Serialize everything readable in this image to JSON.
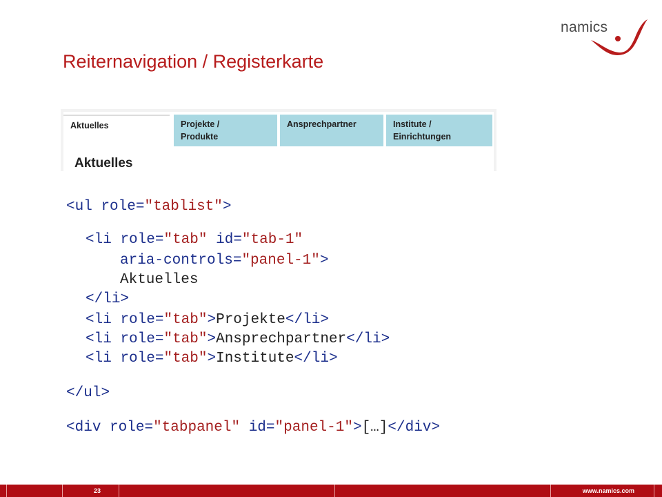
{
  "logo": {
    "text": "namics"
  },
  "title": "Reiternavigation / Registerkarte",
  "tabs": [
    {
      "line1": "Aktuelles",
      "line2": ""
    },
    {
      "line1": "Projekte /",
      "line2": "Produkte"
    },
    {
      "line1": "Ansprechpartner",
      "line2": ""
    },
    {
      "line1": "Institute /",
      "line2": "Einrichtungen"
    }
  ],
  "panel_heading": "Aktuelles",
  "code": {
    "ul_open": {
      "tag": "ul",
      "attr": "role",
      "val": "\"tablist\""
    },
    "li1": {
      "tag": "li",
      "attr1": "role",
      "val1": "\"tab\"",
      "attr2": "id",
      "val2": "\"tab-1\"",
      "attr3": "aria-controls",
      "val3": "\"panel-1\"",
      "text": "Aktuelles",
      "close_tag": "li"
    },
    "li2": {
      "tag": "li",
      "attr": "role",
      "val": "\"tab\"",
      "text": "Projekte",
      "close_tag": "li"
    },
    "li3": {
      "tag": "li",
      "attr": "role",
      "val": "\"tab\"",
      "text": "Ansprechpartner",
      "close_tag": "li"
    },
    "li4": {
      "tag": "li",
      "attr": "role",
      "val": "\"tab\"",
      "text": "Institute",
      "close_tag": "li"
    },
    "ul_close": {
      "tag": "ul"
    },
    "div": {
      "tag": "div",
      "attr1": "role",
      "val1": "\"tabpanel\"",
      "attr2": "id",
      "val2": "\"panel-1\"",
      "text": "[…]",
      "close_tag": "div"
    }
  },
  "footer": {
    "page": "23",
    "url": "www.namics.com"
  },
  "colors": {
    "title": "#b71c1c",
    "footer": "#b00d14",
    "tab_inactive": "#a9d8e2",
    "code_tag": "#1c2f8c",
    "code_value": "#a31d1d"
  }
}
